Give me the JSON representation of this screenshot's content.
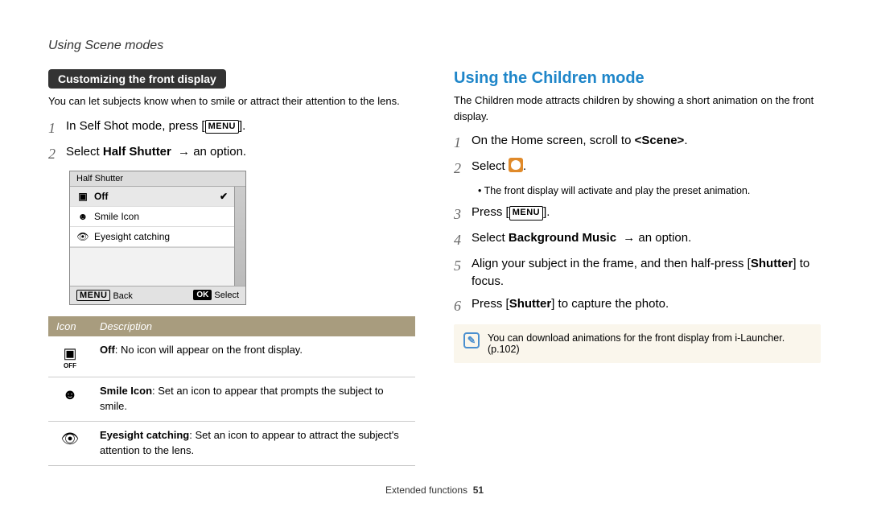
{
  "page_header": "Using Scene modes",
  "left": {
    "pill": "Customizing the front display",
    "intro": "You can let subjects know when to smile or attract their attention to the lens.",
    "step1_pre": "In Self Shot mode, press [",
    "step1_menu": "MENU",
    "step1_post": "].",
    "step2_pre": "Select ",
    "step2_bold": "Half Shutter",
    "step2_post": " → an option.",
    "menu": {
      "title": "Half Shutter",
      "opt_off": "Off",
      "opt_smile": "Smile Icon",
      "opt_eye": "Eyesight catching",
      "footer_back_icon": "MENU",
      "footer_back": "Back",
      "footer_select_icon": "OK",
      "footer_select": "Select"
    },
    "table": {
      "h_icon": "Icon",
      "h_desc": "Description",
      "row_off_bold": "Off",
      "row_off_rest": ": No icon will appear on the front display.",
      "row_smile_bold": "Smile Icon",
      "row_smile_rest": ": Set an icon to appear that prompts the subject to smile.",
      "row_eye_bold": "Eyesight catching",
      "row_eye_rest": ": Set an icon to appear to attract the subject's attention to the lens."
    }
  },
  "right": {
    "heading": "Using the Children mode",
    "intro": "The Children mode attracts children by showing a short animation on the front display.",
    "s1_pre": "On the Home screen, scroll to ",
    "s1_bold": "<Scene>",
    "s1_post": ".",
    "s2_pre": "Select ",
    "s2_post": ".",
    "s2_bullet": "The front display will activate and play the preset animation.",
    "s3_pre": "Press [",
    "s3_menu": "MENU",
    "s3_post": "].",
    "s4_pre": "Select ",
    "s4_bold": "Background Music",
    "s4_post": " → an option.",
    "s5_pre": "Align your subject in the frame, and then half-press [",
    "s5_bold": "Shutter",
    "s5_post": "] to focus.",
    "s6_pre": "Press [",
    "s6_bold": "Shutter",
    "s6_post": "] to capture the photo.",
    "note": "You can download animations for the front display from i-Launcher. (p.102)"
  },
  "footer_text": "Extended functions",
  "footer_page": "51"
}
